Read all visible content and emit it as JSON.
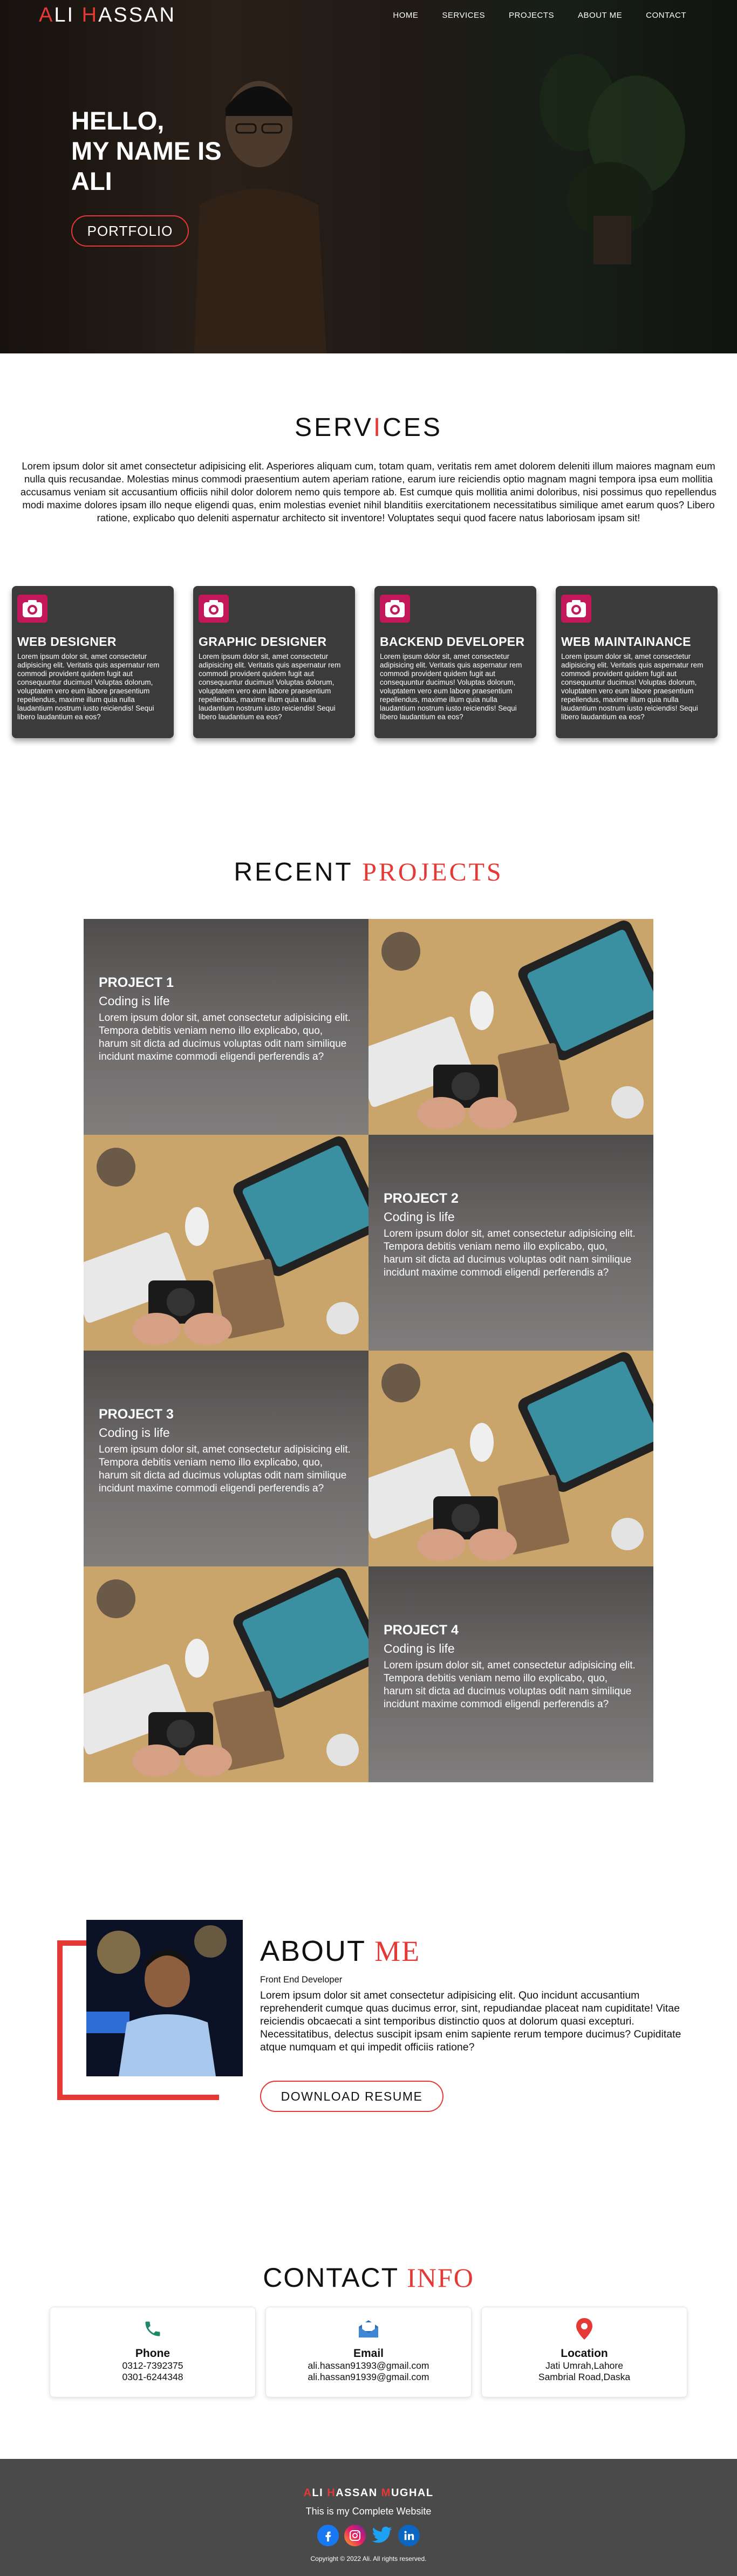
{
  "nav": {
    "logo_parts": [
      "A",
      "LI ",
      "H",
      "ASSAN"
    ],
    "links": [
      "HOME",
      "SERVICES",
      "PROJECTS",
      "ABOUT ME",
      "CONTACT"
    ]
  },
  "hero": {
    "line1": "HELLO,",
    "line2": "MY NAME IS",
    "line3": "ALI",
    "button": "PORTFOLIO"
  },
  "services": {
    "title_parts": [
      "SERV",
      "I",
      "CES"
    ],
    "intro": "Lorem ipsum dolor sit amet consectetur adipisicing elit. Asperiores aliquam cum, totam quam, veritatis rem amet dolorem deleniti illum maiores magnam eum nulla quis recusandae. Molestias minus commodi praesentium autem aperiam ratione, earum iure reiciendis optio magnam magni tempora ipsa eum mollitia accusamus veniam sit accusantium officiis nihil dolor dolorem nemo quis tempore ab. Est cumque quis mollitia animi doloribus, nisi possimus quo repellendus modi maxime dolores ipsam illo neque eligendi quas, enim molestias eveniet nihil blanditiis exercitationem necessitatibus similique amet earum quos? Libero ratione, explicabo quo deleniti aspernatur architecto sit inventore! Voluptates sequi quod facere natus laboriosam ipsam sit!",
    "cards": [
      {
        "title": "WEB DESIGNER",
        "text": "Lorem ipsum dolor sit, amet consectetur adipisicing elit. Veritatis quis aspernatur rem commodi provident quidem fugit aut consequuntur ducimus! Voluptas dolorum, voluptatem vero eum labore praesentium repellendus, maxime illum quia nulla laudantium nostrum iusto reiciendis! Sequi libero laudantium ea eos?"
      },
      {
        "title": "GRAPHIC DESIGNER",
        "text": "Lorem ipsum dolor sit, amet consectetur adipisicing elit. Veritatis quis aspernatur rem commodi provident quidem fugit aut consequuntur ducimus! Voluptas dolorum, voluptatem vero eum labore praesentium repellendus, maxime illum quia nulla laudantium nostrum iusto reiciendis! Sequi libero laudantium ea eos?"
      },
      {
        "title": "BACKEND DEVELOPER",
        "text": "Lorem ipsum dolor sit, amet consectetur adipisicing elit. Veritatis quis aspernatur rem commodi provident quidem fugit aut consequuntur ducimus! Voluptas dolorum, voluptatem vero eum labore praesentium repellendus, maxime illum quia nulla laudantium nostrum iusto reiciendis! Sequi libero laudantium ea eos?"
      },
      {
        "title": "WEB MAINTAINANCE",
        "text": "Lorem ipsum dolor sit, amet consectetur adipisicing elit. Veritatis quis aspernatur rem commodi provident quidem fugit aut consequuntur ducimus! Voluptas dolorum, voluptatem vero eum labore praesentium repellendus, maxime illum quia nulla laudantium nostrum iusto reiciendis! Sequi libero laudantium ea eos?"
      }
    ]
  },
  "projects": {
    "title_main": "RECENT ",
    "title_accent": "PROJECTS",
    "items": [
      {
        "title": "PROJECT 1",
        "subtitle": "Coding is life",
        "text": "Lorem ipsum dolor sit, amet consectetur adipisicing elit. Tempora debitis veniam nemo illo explicabo, quo, harum sit dicta ad ducimus voluptas odit nam similique incidunt maxime commodi eligendi perferendis a?"
      },
      {
        "title": "PROJECT 2",
        "subtitle": "Coding is life",
        "text": "Lorem ipsum dolor sit, amet consectetur adipisicing elit. Tempora debitis veniam nemo illo explicabo, quo, harum sit dicta ad ducimus voluptas odit nam similique incidunt maxime commodi eligendi perferendis a?"
      },
      {
        "title": "PROJECT 3",
        "subtitle": "Coding is life",
        "text": "Lorem ipsum dolor sit, amet consectetur adipisicing elit. Tempora debitis veniam nemo illo explicabo, quo, harum sit dicta ad ducimus voluptas odit nam similique incidunt maxime commodi eligendi perferendis a?"
      },
      {
        "title": "PROJECT 4",
        "subtitle": "Coding is life",
        "text": "Lorem ipsum dolor sit, amet consectetur adipisicing elit. Tempora debitis veniam nemo illo explicabo, quo, harum sit dicta ad ducimus voluptas odit nam similique incidunt maxime commodi eligendi perferendis a?"
      }
    ]
  },
  "about": {
    "title_main": "ABOUT ",
    "title_accent": "ME",
    "role": "Front End Developer",
    "text": "Lorem ipsum dolor sit amet consectetur adipisicing elit. Quo incidunt accusantium reprehenderit cumque quas ducimus error, sint, repudiandae placeat nam cupiditate! Vitae reiciendis obcaecati a sint temporibus distinctio quos at dolorum quasi excepturi. Necessitatibus, delectus suscipit ipsam enim sapiente rerum tempore ducimus? Cupiditate atque numquam et qui impedit officiis ratione?",
    "button": "DOWNLOAD RESUME"
  },
  "contact": {
    "title_main": "CONTACT ",
    "title_accent": "INFO",
    "cards": [
      {
        "icon": "phone-icon",
        "label": "Phone",
        "lines": [
          "0312-7392375",
          "0301-6244348"
        ]
      },
      {
        "icon": "email-icon",
        "label": "Email",
        "lines": [
          "ali.hassan91393@gmail.com",
          "ali.hassan91939@gmail.com"
        ]
      },
      {
        "icon": "location-pin-icon",
        "label": "Location",
        "lines": [
          "Jati Umrah,Lahore",
          "Sambrial Road,Daska"
        ]
      }
    ]
  },
  "footer": {
    "name_parts": [
      "A",
      "LI ",
      "H",
      "ASSAN ",
      "M",
      "UGHAL"
    ],
    "tagline": "This is my Complete Website",
    "socials": [
      "facebook-icon",
      "instagram-icon",
      "twitter-icon",
      "linkedin-icon"
    ],
    "copyright": "Copyright © 2022 Ali. All rights reserved."
  },
  "colors": {
    "accent": "#e53935",
    "card_bg": "#3b3b3b",
    "footer_bg": "#4a4a4a"
  }
}
